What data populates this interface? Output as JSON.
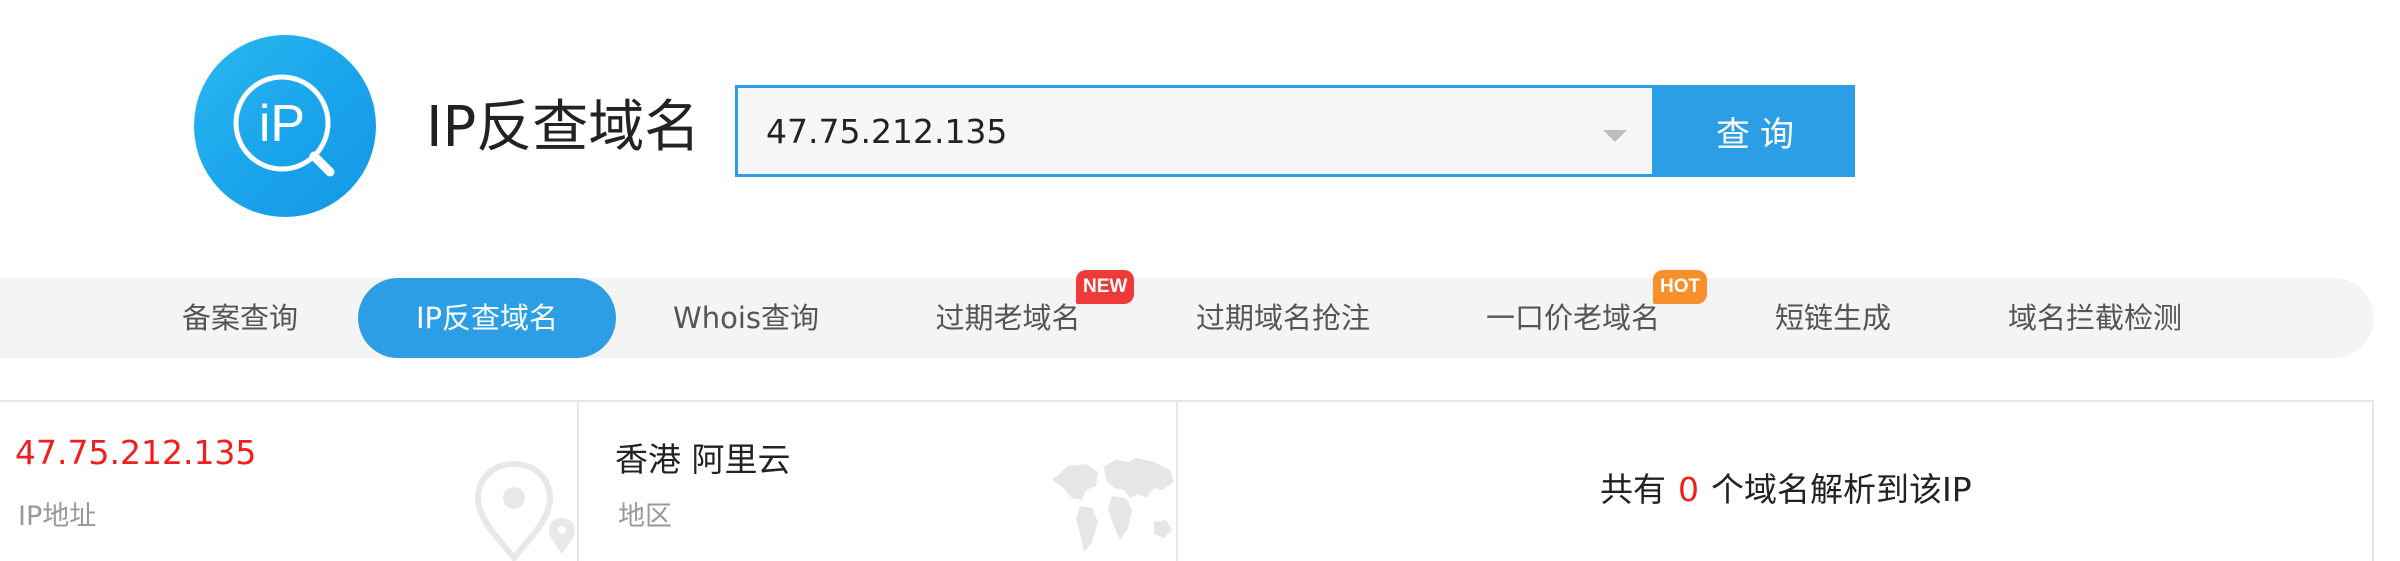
{
  "header": {
    "logo_text": "iP",
    "title": "IP反查域名"
  },
  "search": {
    "value": "47.75.212.135",
    "button_label": "查询"
  },
  "nav": {
    "items": [
      {
        "label": "备案查询"
      },
      {
        "label": "IP反查域名",
        "active": true
      },
      {
        "label": "Whois查询"
      },
      {
        "label": "过期老域名",
        "badge": "NEW"
      },
      {
        "label": "过期域名抢注"
      },
      {
        "label": "一口价老域名",
        "badge": "HOT"
      },
      {
        "label": "短链生成"
      },
      {
        "label": "域名拦截检测"
      }
    ]
  },
  "info": {
    "ip": {
      "value": "47.75.212.135",
      "label": "IP地址",
      "icon": "location-pin-icon"
    },
    "region": {
      "value": "香港 阿里云",
      "label": "地区",
      "icon": "world-map-icon"
    },
    "summary": {
      "prefix": "共有",
      "count": "0",
      "suffix": "个域名解析到该IP"
    }
  },
  "colors": {
    "accent": "#2b9ee6",
    "highlight_red": "#f21d1d",
    "badge_new": "#ef3a3a",
    "badge_hot": "#f7902a"
  }
}
